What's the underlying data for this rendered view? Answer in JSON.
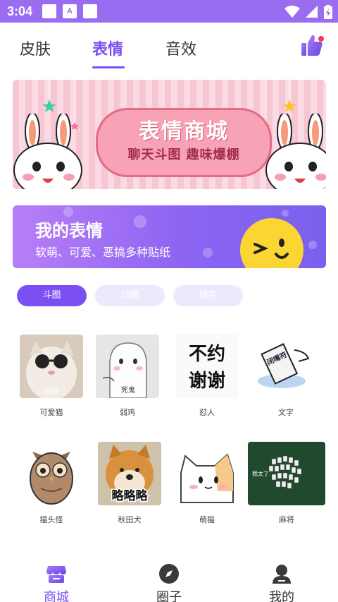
{
  "status_bar": {
    "time": "3:04",
    "icons": [
      "square-icon",
      "a-icon",
      "square-icon",
      "wifi-icon",
      "signal-icon",
      "battery-icon"
    ]
  },
  "tabs": [
    {
      "label": "皮肤",
      "active": false
    },
    {
      "label": "表情",
      "active": true
    },
    {
      "label": "音效",
      "active": false
    }
  ],
  "banner": {
    "title": "表情商城",
    "subtitle": "聊天斗图 趣味爆棚"
  },
  "my_card": {
    "title": "我的表情",
    "subtitle": "软萌、可爱、恶搞多种贴纸"
  },
  "chips": [
    {
      "label": "斗图",
      "active": true
    },
    {
      "label": "动图",
      "active": false
    },
    {
      "label": "搞笑",
      "active": false
    }
  ],
  "stickers": [
    {
      "label": "可爱猫",
      "overlay": "冷酷"
    },
    {
      "label": "弱鸡",
      "overlay": "死鬼"
    },
    {
      "label": "怼人",
      "overlay": "不约 谢谢",
      "line1": "不约",
      "line2": "谢谢"
    },
    {
      "label": "文字",
      "overlay": "闭嘴符"
    },
    {
      "label": "猫头怪",
      "overlay": ""
    },
    {
      "label": "秋田犬",
      "overlay": "略略略"
    },
    {
      "label": "萌猫",
      "overlay": ""
    },
    {
      "label": "麻将",
      "overlay": "我太了"
    }
  ],
  "bottom_nav": [
    {
      "label": "商城",
      "active": true,
      "icon": "store-icon"
    },
    {
      "label": "圈子",
      "active": false,
      "icon": "compass-icon"
    },
    {
      "label": "我的",
      "active": false,
      "icon": "user-icon"
    }
  ],
  "colors": {
    "accent": "#7b4ff2",
    "status_bar": "#9a6cf0",
    "chip_inactive": "#ede8fc"
  }
}
